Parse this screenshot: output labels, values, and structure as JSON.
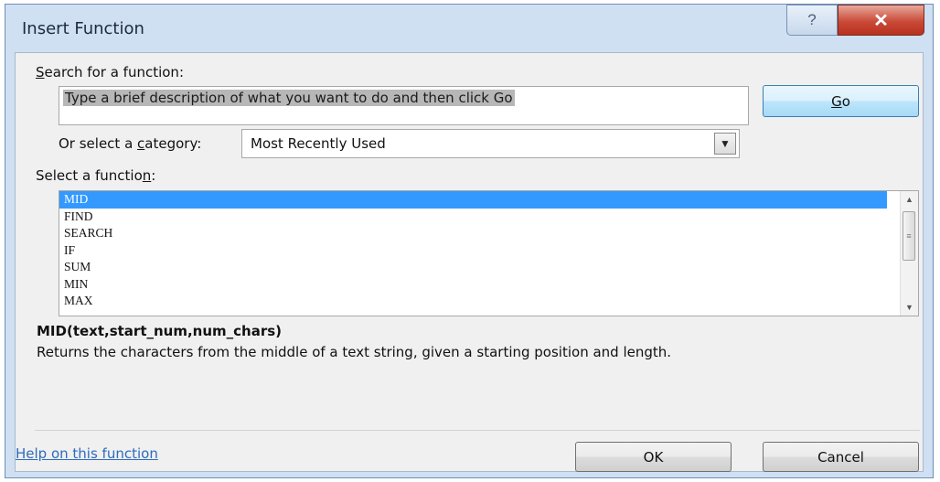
{
  "window": {
    "title": "Insert Function",
    "help_glyph": "?",
    "close_glyph": "✕"
  },
  "search": {
    "label_pre": "",
    "label_key": "S",
    "label_post": "earch for a function:",
    "value": "Type a brief description of what you want to do and then click Go",
    "go_key": "G",
    "go_rest": "o"
  },
  "category": {
    "label_pre": "Or select a ",
    "label_key": "c",
    "label_post": "ategory:",
    "selected": "Most Recently Used"
  },
  "functions": {
    "label_pre": "Select a functio",
    "label_key": "n",
    "label_post": ":",
    "items": [
      "MID",
      "FIND",
      "SEARCH",
      "IF",
      "SUM",
      "MIN",
      "MAX"
    ],
    "selected_index": 0
  },
  "detail": {
    "signature": "MID(text,start_num,num_chars)",
    "description": "Returns the characters from the middle of a text string, given a starting position and length."
  },
  "footer": {
    "help_link": "Help on this function",
    "ok": "OK",
    "cancel": "Cancel"
  }
}
